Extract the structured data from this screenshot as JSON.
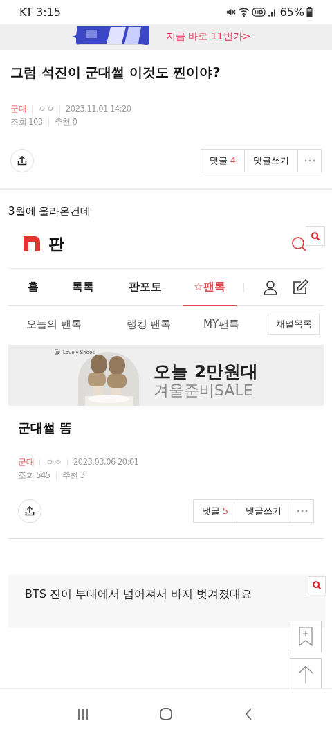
{
  "status_bar": {
    "time": "KT 3:15",
    "battery": "65%"
  },
  "top_ad": {
    "kind": "picture",
    "text": "지금 바로 11번가>"
  },
  "post": {
    "title": "그럼 석진이 군대썰 이것도 찐이야?",
    "category": "군대",
    "author": "ㅇㅇ",
    "date": "2023.11.01 14:20",
    "views": "조회 103",
    "likes": "추천 0",
    "comment_label": "댓글",
    "comment_count": "4",
    "write_comment": "댓글쓰기"
  },
  "body_text": "3월에 올라온건데",
  "embedded": {
    "logo_text": "판",
    "nav_tabs": [
      {
        "label": "홈",
        "selected": false
      },
      {
        "label": "톡톡",
        "selected": false
      },
      {
        "label": "판포토",
        "selected": false
      },
      {
        "label": "☆팬톡",
        "selected": true
      }
    ],
    "sub_tabs": [
      "오늘의 팬톡",
      "랭킹 팬톡",
      "MY팬톡"
    ],
    "channel_button": "채널목록",
    "ad": {
      "brand": "Lovely Shoes",
      "headline": "오늘 2만원대",
      "subline": "겨울준비SALE"
    },
    "post": {
      "title": "군대썰 뜸",
      "category": "군대",
      "author": "ㅇㅇ",
      "date": "2023.03.06 20:01",
      "views": "조회 545",
      "likes": "추천 3",
      "comment_label": "댓글",
      "comment_count": "5",
      "write_comment": "댓글쓰기"
    }
  },
  "image_caption": "BTS 진이 부대에서 넘어져서 바지 벗겨졌대요"
}
